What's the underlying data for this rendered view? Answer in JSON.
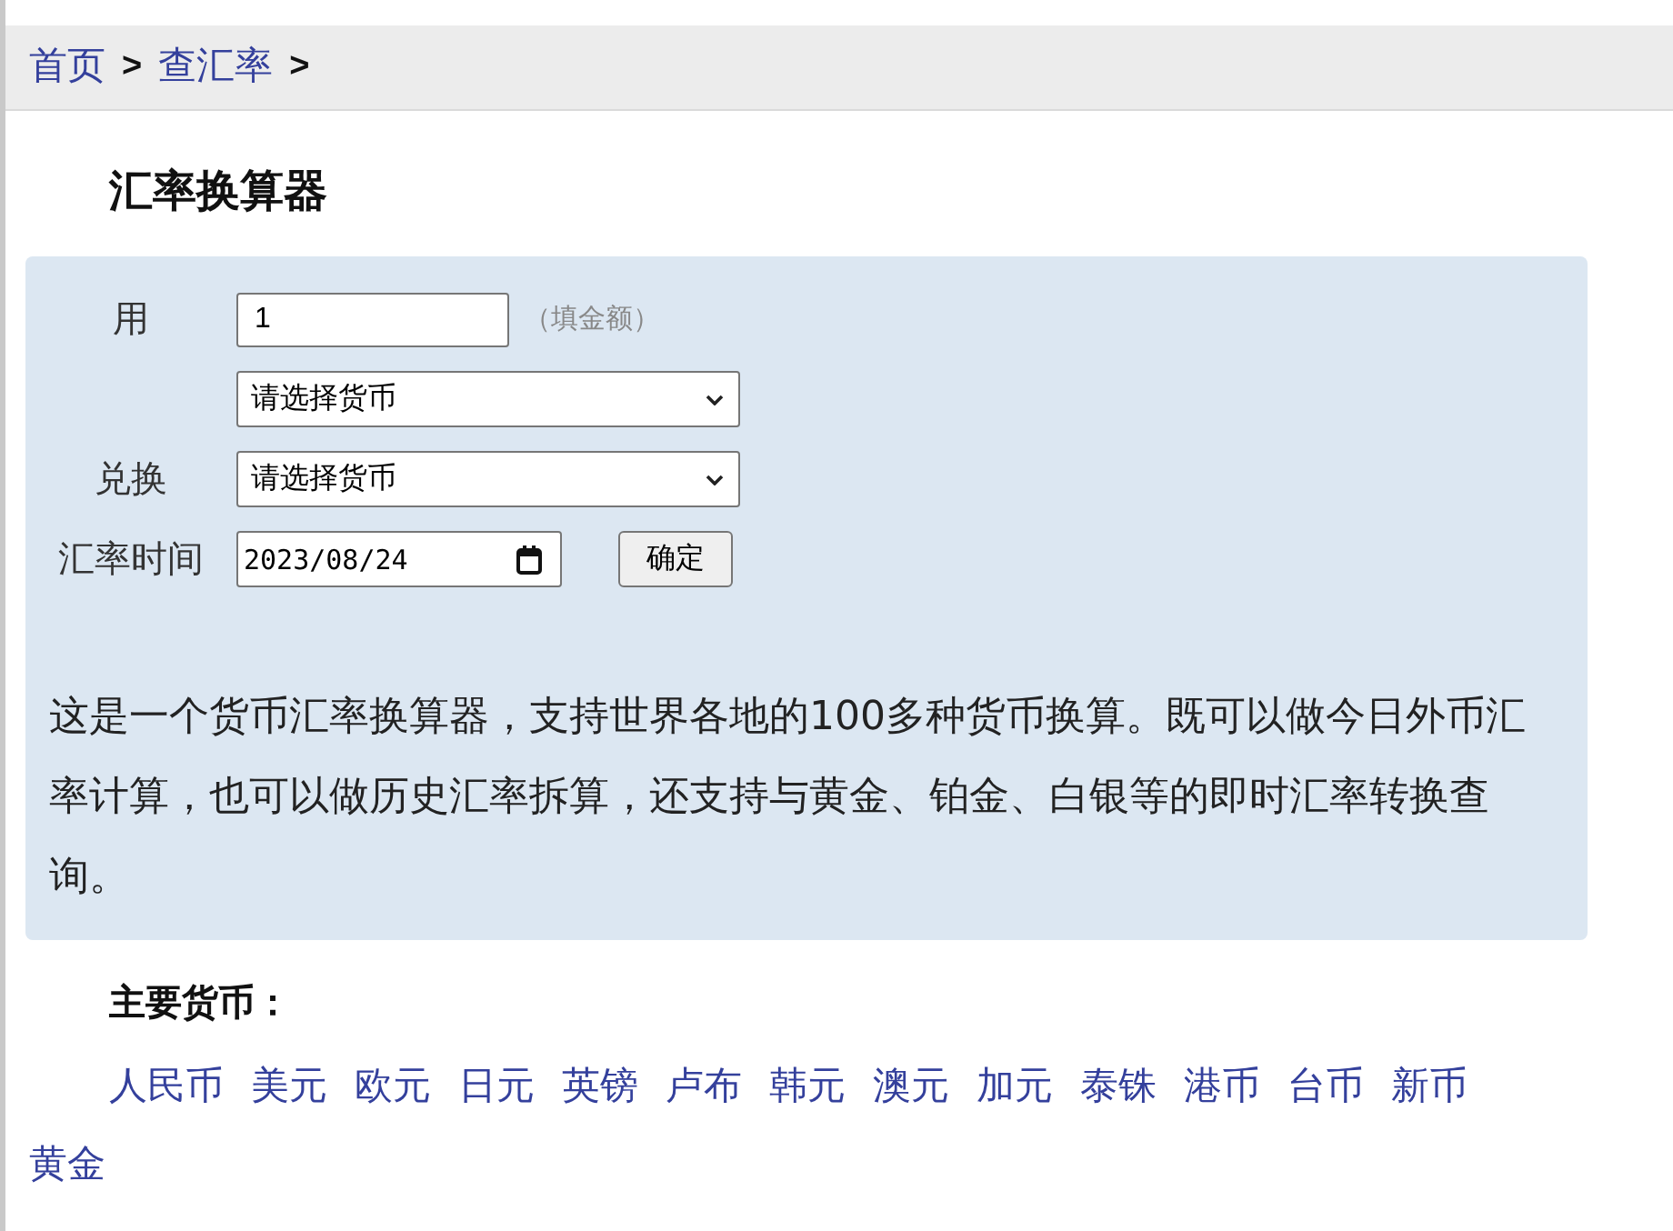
{
  "breadcrumb": [
    {
      "label": "首页",
      "separator": ">"
    },
    {
      "label": "查汇率",
      "separator": ">"
    }
  ],
  "title": "汇率换算器",
  "converter": {
    "amount": {
      "label": "用",
      "value": "1",
      "hint": "（填金额）"
    },
    "from_currency": {
      "value": "请选择货币"
    },
    "to_currency": {
      "label": "兑换",
      "value": "请选择货币"
    },
    "date": {
      "label": "汇率时间",
      "value": "2023/08/24"
    },
    "submit_button": "确定",
    "description": "这是一个货币汇率换算器，支持世界各地的100多种货币换算。既可以做今日外币汇率计算，也可以做历史汇率拆算，还支持与黄金、铂金、白银等的即时汇率转换查询。"
  },
  "main_currencies": {
    "heading": "主要货币：",
    "links": [
      "人民币",
      "美元",
      "欧元",
      "日元",
      "英镑",
      "卢布",
      "韩元",
      "澳元",
      "加元",
      "泰铢",
      "港币",
      "台币",
      "新币",
      "黄金"
    ]
  }
}
